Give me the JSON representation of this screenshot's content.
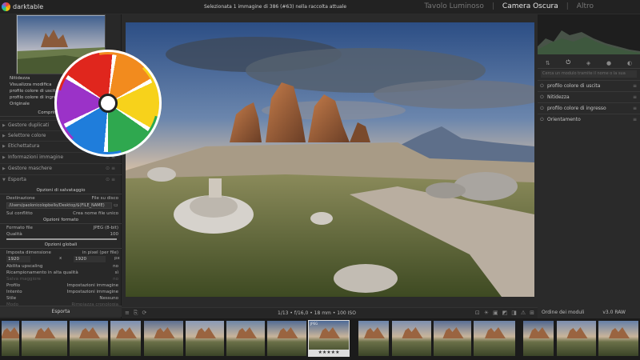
{
  "app": {
    "name": "darktable",
    "status": "Selezionata 1 immagine di 386 (#63) nella raccolta attuale",
    "views": [
      "Tavolo Luminoso",
      "Camera Oscura",
      "Altro"
    ],
    "active_view": "Camera Oscura"
  },
  "left_panel": {
    "history": [
      "Nitidezza",
      "Visualizza modifica",
      "profilo colore di uscita",
      "profilo colore di ingresso",
      "Originale"
    ],
    "compress_button": "Comprimi cronologia",
    "sections": [
      "Gestore duplicati",
      "Selettore colore",
      "Etichettatura",
      "Informazioni immagine",
      "Gestore maschere",
      "Esporta"
    ],
    "export": {
      "storage_header": "Opzioni di salvataggio",
      "destination_label": "Destinazione",
      "destination_value": "File su disco",
      "path": "/Users/paolonicolopbello/Desktop/$(FILE_NAME)",
      "conflict_label": "Sul conflitto",
      "conflict_value": "Crea nome file unico",
      "format_header": "Opzioni formato",
      "format_label": "Formato file",
      "format_value": "JPEG (8-bit)",
      "quality_label": "Qualità",
      "quality_value": "100",
      "quality_level": 1.0,
      "global_header": "Opzioni globali",
      "size_label": "Imposta dimensione",
      "size_value": "in pixel (per file)",
      "width": "1920",
      "times": "x",
      "height": "1920",
      "px": "px",
      "upscale_label": "Abilita upscaling",
      "upscale_value": "no",
      "hq_label": "Ricampionamento in alta qualità",
      "hq_value": "sì",
      "saved_label": "Salva maggiore",
      "saved_value": "no",
      "profile_label": "Profilo",
      "profile_value": "Impostazioni immagine",
      "intent_label": "Intento",
      "intent_value": "Impostazioni immagine",
      "style_label": "Stile",
      "style_value": "Nessuno",
      "mode_label": "Modo",
      "mode_value": "Rimpiazza cronologia",
      "export_button": "Esporta"
    }
  },
  "center": {
    "info": "1/13 • f/16,0 • 18 mm • 100 ISO"
  },
  "right_panel": {
    "search_placeholder": "Cerca un modulo tramite il nome o la sua",
    "modules": [
      "profilo colore di uscita",
      "Nitidezza",
      "profilo colore di ingresso",
      "Orientamento"
    ],
    "module_order_label": "Ordine dei moduli",
    "module_order_value": "v3.0 RAW"
  },
  "filmstrip": {
    "selected_tag": "JPEG",
    "selected_stars": "★★★★★"
  },
  "colors": {
    "bg": "#1e1e1e",
    "panel": "#282828",
    "accent": "#dddddd"
  }
}
